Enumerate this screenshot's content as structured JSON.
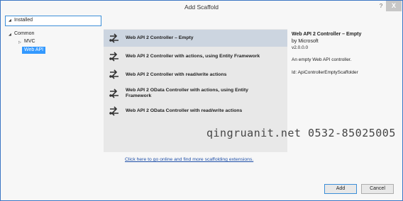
{
  "window": {
    "title": "Add Scaffold",
    "help": "?",
    "close": "X"
  },
  "filter": {
    "installed_label": "Installed"
  },
  "tree": {
    "common": "Common",
    "mvc": "MVC",
    "webapi": "Web API"
  },
  "scaffolders": [
    {
      "label": "Web API 2 Controller – Empty",
      "selected": true
    },
    {
      "label": "Web API 2 Controller with actions, using Entity Framework",
      "selected": false
    },
    {
      "label": "Web API 2 Controller with read/write actions",
      "selected": false
    },
    {
      "label_line1": "Web API 2 OData Controller with actions, using Entity",
      "label_line2": "Framework",
      "selected": false
    },
    {
      "label": "Web API 2 OData Controller with read/write actions",
      "selected": false
    }
  ],
  "details": {
    "title": "Web API 2 Controller – Empty",
    "by": "by Microsoft",
    "version": "v2.0.0.0",
    "description": "An empty Web API controller.",
    "id": "Id: ApiControllerEmptyScaffolder"
  },
  "link_text": "Click here to go online and find more scaffolding extensions.",
  "watermark": "qingruanit.net 0532-85025005",
  "buttons": {
    "add": "Add",
    "cancel": "Cancel"
  }
}
